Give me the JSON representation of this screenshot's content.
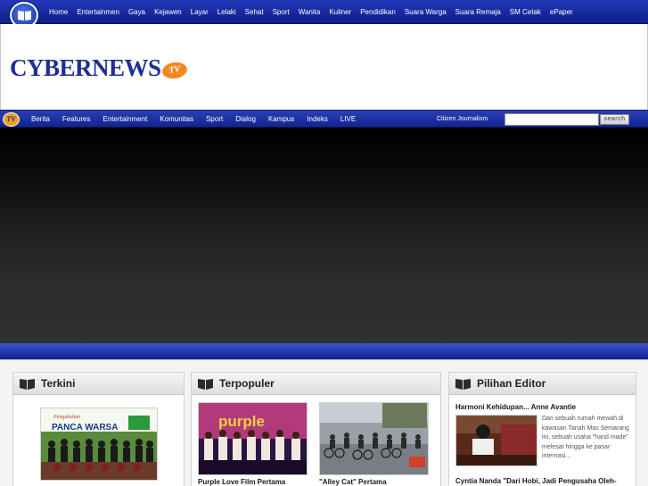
{
  "top_nav": {
    "links": [
      "Home",
      "Entertainmen",
      "Gaya",
      "Kejawen",
      "Layar",
      "Lelaki",
      "Sehat",
      "Sport",
      "Wanita",
      "Kuliner",
      "Pendidikan",
      "Suara Warga",
      "Suara Remaja",
      "SM Cetak",
      "ePaper"
    ]
  },
  "brand": {
    "name": "CYBERNEWS",
    "suffix": "TV"
  },
  "main_nav": {
    "icon_text": "TV",
    "links": [
      "Berita",
      "Features",
      "Entertainment",
      "Komunitas",
      "Sport",
      "Dialog",
      "Kampus",
      "Indeks",
      "LIVE"
    ],
    "citizen_label": "Citizen Journalism",
    "search_value": "",
    "search_button": "search"
  },
  "columns": {
    "terkini": {
      "title": "Terkini",
      "image_text_line1": "Pengukuhan",
      "image_text_line2": "PANCA WARSA"
    },
    "terpopuler": {
      "title": "Terpopuler",
      "items": [
        {
          "caption": "Purple Love Film Pertama",
          "image_text": "purple"
        },
        {
          "caption": "\"Alley Cat\" Pertama"
        }
      ]
    },
    "pilihan_editor": {
      "title": "Pilihan Editor",
      "headline": "Harmoni Kehidupan... Anne Avantie",
      "summary": "Dari sebuah rumah mewah di kawasan Tanah Mas Semarang ini, sebuah usaha \"hand made\" melesat hingga ke pasar internasi...",
      "headline2": "Cyntia Nanda \"Dari Hobi, Jadi Pengusaha Oleh-"
    }
  },
  "colors": {
    "nav_blue": "#13248e",
    "brand_blue": "#1f2d95",
    "brand_orange": "#f08a20"
  }
}
